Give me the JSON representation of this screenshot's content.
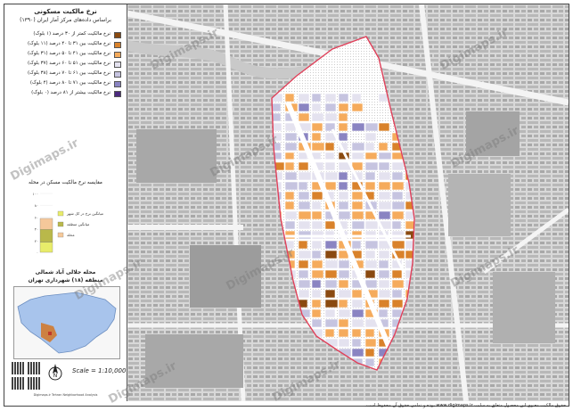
{
  "header": {
    "title": "نرخ مالکیت مسکونی",
    "subtitle": "براساس داده‌های مرکز آمار ایران (۱۳۹۰)"
  },
  "legend": {
    "items": [
      {
        "label": "نرخ مالکیت کمتر از ۳۰ درصد (۱ بلوک)",
        "color": "#8a4a10"
      },
      {
        "label": "نرخ مالکیت بین ۳۱ تا ۴۰ درصد (۱۱ بلوک)",
        "color": "#d9822b"
      },
      {
        "label": "نرخ مالکیت بین ۴۱ تا ۵۰ درصد (۳۱ بلوک)",
        "color": "#f5ab5c"
      },
      {
        "label": "نرخ مالکیت بین ۵۱ تا ۶۰ درصد (۳۷ بلوک)",
        "color": "#e4e2ef"
      },
      {
        "label": "نرخ مالکیت بین ۶۱ تا ۷۰ درصد (۳۸ بلوک)",
        "color": "#c6c4e0"
      },
      {
        "label": "نرخ مالکیت بین ۷۱ تا ۸۰ درصد (۴ بلوک)",
        "color": "#8a84c2"
      },
      {
        "label": "نرخ مالکیت بیشتر از ۸۱ درصد (۰ بلوک)",
        "color": "#4b2a7e"
      }
    ]
  },
  "chart_data": {
    "type": "bar",
    "title": "مقایسه نرخ مالکیت مسکن در محله",
    "categories": [
      "محله"
    ],
    "series": [
      {
        "name": "محله",
        "values": [
          48
        ],
        "color": "#e8ec6a"
      },
      {
        "name": "منطقه",
        "values": [
          60
        ],
        "color": "#b9b84a"
      },
      {
        "name": "شهر",
        "values": [
          52
        ],
        "color": "#f5c89a"
      }
    ],
    "ytick_labels": [
      "۱۰۰",
      "۸۰",
      "۶۰",
      "۴۰",
      "۲۰",
      "۰"
    ],
    "ylim": [
      0,
      100
    ],
    "legend_labels": [
      "میانگین نرخ در کل شهر",
      "میانگین منطقه",
      "محله"
    ]
  },
  "area": {
    "line1": "محله جلالی آباد شمالی",
    "line2": "منطقه (۱۸) شهرداری تهران"
  },
  "scale": {
    "text": "Scale = 1:10,000"
  },
  "credit_side": "Digimaps.ir Tehran Neighborhood Analysis",
  "footer": {
    "text": "حقوق مالکیت معنوی این محصول متعلق به سایت www.digimaps.ir بوده و تمامی حقوق آن محفوظ است."
  },
  "watermark": {
    "text": "Digimaps.ir"
  },
  "colors": {
    "background": "#d8d8d8",
    "road": "#f4f4f4",
    "building": "#9a9a9a",
    "boundary": "#e0405a"
  }
}
